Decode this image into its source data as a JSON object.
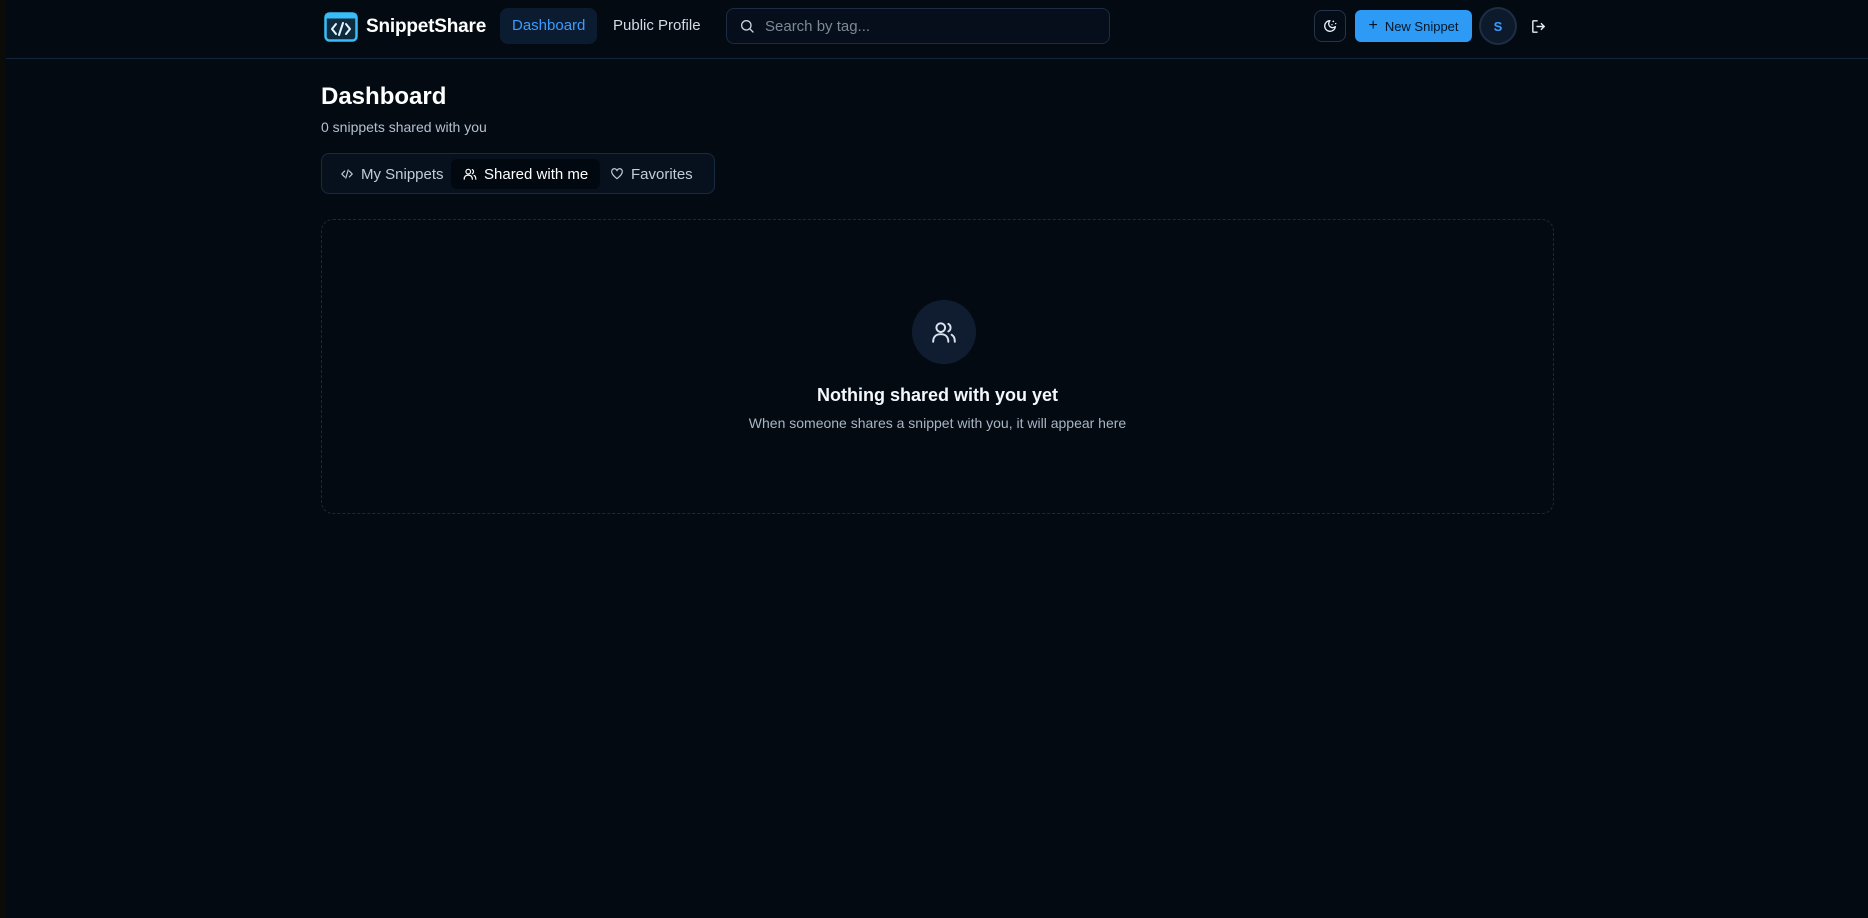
{
  "header": {
    "brand_name": "SnippetShare",
    "nav": {
      "dashboard": "Dashboard",
      "public_profile": "Public Profile"
    },
    "search_placeholder": "Search by tag...",
    "new_snippet_label": "New Snippet",
    "avatar_initial": "S",
    "icons": {
      "logo": "code-window-icon",
      "search": "search-icon",
      "theme": "theme-toggle-icon",
      "new": "plus-icon",
      "logout": "logout-icon"
    }
  },
  "page": {
    "title": "Dashboard",
    "subtitle": "0 snippets shared with you"
  },
  "tabs": {
    "my_snippets": "My Snippets",
    "shared_with_me": "Shared with me",
    "favorites": "Favorites",
    "active": "shared_with_me"
  },
  "empty_state": {
    "icon": "users-icon",
    "title": "Nothing shared with you yet",
    "description": "When someone shares a snippet with you, it will appear here"
  },
  "colors": {
    "background": "#030a12",
    "accent": "#2d9af5",
    "active_nav_text": "#3b9cff",
    "border": "#1a2a40"
  }
}
